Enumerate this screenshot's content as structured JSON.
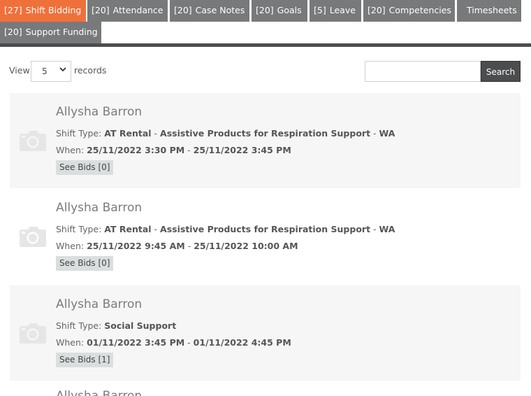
{
  "tabs": [
    {
      "count": "[27]",
      "label": "Shift Bidding",
      "active": true
    },
    {
      "count": "[20]",
      "label": "Attendance"
    },
    {
      "count": "[20]",
      "label": "Case Notes"
    },
    {
      "count": "[20]",
      "label": "Goals"
    },
    {
      "count": "[5]",
      "label": "Leave"
    },
    {
      "count": "[20]",
      "label": "Competencies"
    },
    {
      "count": "",
      "label": "Timesheets"
    },
    {
      "count": "[20]",
      "label": "Support Funding"
    }
  ],
  "colors": {
    "active_tab": "#f0703a",
    "tab": "#77797a",
    "dark": "#4b4d4e"
  },
  "toolbar": {
    "view_label": "View",
    "page_size": "5",
    "records_label": "records",
    "search_placeholder": "",
    "search_label": "Search"
  },
  "shifts": [
    {
      "name": "Allysha Barron",
      "shift_type_label": "Shift Type:",
      "shift_type_parts": [
        "AT Rental",
        "Assistive Products for Respiration Support",
        "WA"
      ],
      "when_label": "When:",
      "start": "25/11/2022 3:30 PM",
      "end": "25/11/2022 3:45 PM",
      "bids_label": "See Bids [0]"
    },
    {
      "name": "Allysha Barron",
      "shift_type_label": "Shift Type:",
      "shift_type_parts": [
        "AT Rental",
        "Assistive Products for Respiration Support",
        "WA"
      ],
      "when_label": "When:",
      "start": "25/11/2022 9:45 AM",
      "end": "25/11/2022 10:00 AM",
      "bids_label": "See Bids [0]"
    },
    {
      "name": "Allysha Barron",
      "shift_type_label": "Shift Type:",
      "shift_type_parts": [
        "Social Support"
      ],
      "when_label": "When:",
      "start": "01/11/2022 3:45 PM",
      "end": "01/11/2022 4:45 PM",
      "bids_label": "See Bids [1]"
    }
  ],
  "partial_name": "Allysha Barron",
  "icons": {
    "avatar": "camera-icon",
    "dropdown": "chevron-down-icon"
  }
}
